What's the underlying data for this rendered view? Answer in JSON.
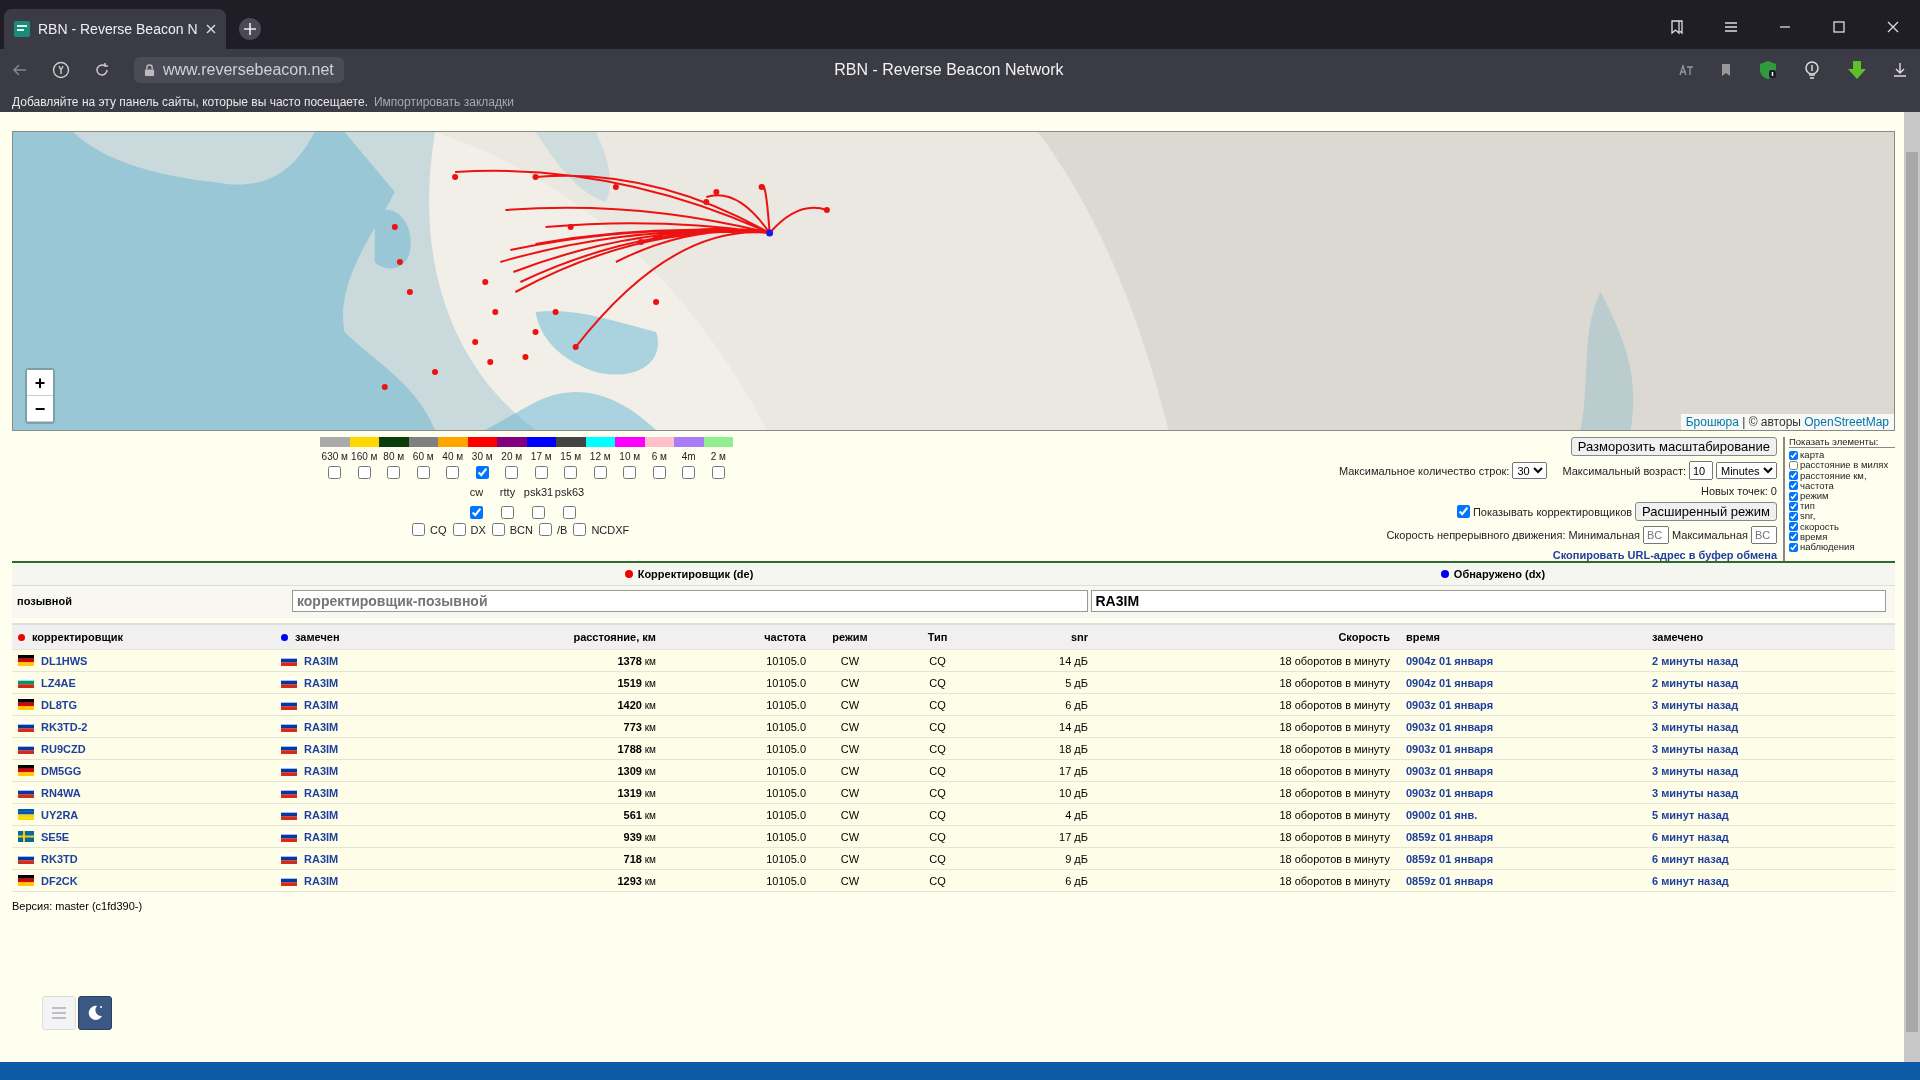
{
  "browser": {
    "tab_title": "RBN - Reverse Beacon N",
    "url": "www.reversebeacon.net",
    "page_title": "RBN - Reverse Beacon Network",
    "bookmarks_hint": "Добавляйте на эту панель сайты, которые вы часто посещаете.",
    "import_link": "Импортировать закладки"
  },
  "map": {
    "zoom_in": "+",
    "zoom_out": "−",
    "attribution_link": "Брошюра",
    "attribution_text": " | © авторы ",
    "osm_link": "OpenStreetMap"
  },
  "bands": [
    {
      "label": "630 м",
      "color": "#aaaaaa",
      "checked": false
    },
    {
      "label": "160 м",
      "color": "#ffd700",
      "checked": false
    },
    {
      "label": "80 м",
      "color": "#0b3d0b",
      "checked": false
    },
    {
      "label": "60 м",
      "color": "#808080",
      "checked": false
    },
    {
      "label": "40 м",
      "color": "#ffa500",
      "checked": false
    },
    {
      "label": "30 м",
      "color": "#ff0000",
      "checked": true
    },
    {
      "label": "20 м",
      "color": "#800080",
      "checked": false
    },
    {
      "label": "17 м",
      "color": "#0000ff",
      "checked": false
    },
    {
      "label": "15 м",
      "color": "#444444",
      "checked": false
    },
    {
      "label": "12 м",
      "color": "#00ffff",
      "checked": false
    },
    {
      "label": "10 м",
      "color": "#ff00ff",
      "checked": false
    },
    {
      "label": "6 м",
      "color": "#ffc0cb",
      "checked": false
    },
    {
      "label": "4m",
      "color": "#a87cf7",
      "checked": false
    },
    {
      "label": "2 м",
      "color": "#90ee90",
      "checked": false
    }
  ],
  "modes": [
    {
      "label": "cw",
      "checked": true
    },
    {
      "label": "rtty",
      "checked": false
    },
    {
      "label": "psk31",
      "checked": false
    },
    {
      "label": "psk63",
      "checked": false
    }
  ],
  "types": [
    {
      "label": "CQ",
      "checked": false
    },
    {
      "label": "DX",
      "checked": false
    },
    {
      "label": "BCN",
      "checked": false
    },
    {
      "label": "/B",
      "checked": false
    },
    {
      "label": "NCDXF",
      "checked": false
    }
  ],
  "controls": {
    "unfreeze_button": "Разморозить масштабирование",
    "max_rows_label": "Максимальное количество строк:",
    "max_rows_value": "30",
    "max_age_label": "Максимальный возраст:",
    "max_age_value": "10",
    "age_unit": "Minutes",
    "new_points": "Новых точек: 0",
    "show_spotters_label": "Показывать корректировщиков",
    "show_spotters_checked": true,
    "advanced_button": "Расширенный режим",
    "speed_label": "Скорость непрерывного движения: Минимальная",
    "min_placeholder": "BC",
    "max_label": "Максимальная",
    "max_placeholder": "BC",
    "copy_link": "Скопировать URL-адрес в буфер обмена"
  },
  "show_elements": {
    "title": "Показать элементы:",
    "items": [
      {
        "label": "карта",
        "checked": true
      },
      {
        "label": "расстояние в милях",
        "checked": false
      },
      {
        "label": "расстояние км,",
        "checked": true
      },
      {
        "label": "частота",
        "checked": true
      },
      {
        "label": "режим",
        "checked": true
      },
      {
        "label": "тип",
        "checked": true
      },
      {
        "label": "snr,",
        "checked": true
      },
      {
        "label": "скорость",
        "checked": true
      },
      {
        "label": "время",
        "checked": true
      },
      {
        "label": "наблюдения",
        "checked": true
      }
    ]
  },
  "filter": {
    "de_header": "Корректировщик (de)",
    "dx_header": "Обнаружено (dx)",
    "row_label": "позывной",
    "de_placeholder": "корректировщик-позывной",
    "dx_value": "RA3IM"
  },
  "table": {
    "columns": [
      "корректировщик",
      "замечен",
      "расстояние, км",
      "частота",
      "режим",
      "Тип",
      "snr",
      "Скорость",
      "время",
      "замечено"
    ],
    "rows": [
      {
        "spotter_flag": {
          "kind": "de"
        },
        "spotter": "DL1HWS",
        "spotted_flag": {
          "kind": "ru"
        },
        "spotted": "RA3IM",
        "distance": "**1378** км",
        "frequency": "10105.0",
        "mode": "CW",
        "type": "CQ",
        "snr": "14 дБ",
        "speed": "18 оборотов в минуту",
        "time": "0904z 01 января",
        "seen": "2 минуты назад"
      },
      {
        "spotter_flag": {
          "kind": "bg"
        },
        "spotter": "LZ4AE",
        "spotted_flag": {
          "kind": "ru"
        },
        "spotted": "RA3IM",
        "distance": "**1519** км",
        "frequency": "10105.0",
        "mode": "CW",
        "type": "CQ",
        "snr": "5 дБ",
        "speed": "18 оборотов в минуту",
        "time": "0904z 01 января",
        "seen": "2 минуты назад"
      },
      {
        "spotter_flag": {
          "kind": "de"
        },
        "spotter": "DL8TG",
        "spotted_flag": {
          "kind": "ru"
        },
        "spotted": "RA3IM",
        "distance": "**1420** км",
        "frequency": "10105.0",
        "mode": "CW",
        "type": "CQ",
        "snr": "6 дБ",
        "speed": "18 оборотов в минуту",
        "time": "0903z 01 января",
        "seen": "3 минуты назад"
      },
      {
        "spotter_flag": {
          "kind": "ru"
        },
        "spotter": "RK3TD-2",
        "spotted_flag": {
          "kind": "ru"
        },
        "spotted": "RA3IM",
        "distance": "**773** км",
        "frequency": "10105.0",
        "mode": "CW",
        "type": "CQ",
        "snr": "14 дБ",
        "speed": "18 оборотов в минуту",
        "time": "0903z 01 января",
        "seen": "3 минуты назад"
      },
      {
        "spotter_flag": {
          "kind": "ru"
        },
        "spotter": "RU9CZD",
        "spotted_flag": {
          "kind": "ru"
        },
        "spotted": "RA3IM",
        "distance": "**1788** км",
        "frequency": "10105.0",
        "mode": "CW",
        "type": "CQ",
        "snr": "18 дБ",
        "speed": "18 оборотов в минуту",
        "time": "0903z 01 января",
        "seen": "3 минуты назад"
      },
      {
        "spotter_flag": {
          "kind": "de"
        },
        "spotter": "DM5GG",
        "spotted_flag": {
          "kind": "ru"
        },
        "spotted": "RA3IM",
        "distance": "**1309** км",
        "frequency": "10105.0",
        "mode": "CW",
        "type": "CQ",
        "snr": "17 дБ",
        "speed": "18 оборотов в минуту",
        "time": "0903z 01 января",
        "seen": "3 минуты назад"
      },
      {
        "spotter_flag": {
          "kind": "ru"
        },
        "spotter": "RN4WA",
        "spotted_flag": {
          "kind": "ru"
        },
        "spotted": "RA3IM",
        "distance": "**1319** км",
        "frequency": "10105.0",
        "mode": "CW",
        "type": "CQ",
        "snr": "10 дБ",
        "speed": "18 оборотов в минуту",
        "time": "0903z 01 января",
        "seen": "3 минуты назад"
      },
      {
        "spotter_flag": {
          "kind": "ua"
        },
        "spotter": "UY2RA",
        "spotted_flag": {
          "kind": "ru"
        },
        "spotted": "RA3IM",
        "distance": "**561** км",
        "frequency": "10105.0",
        "mode": "CW",
        "type": "CQ",
        "snr": "4 дБ",
        "speed": "18 оборотов в минуту",
        "time": "0900z 01 янв.",
        "seen": "5 минут назад"
      },
      {
        "spotter_flag": {
          "kind": "se"
        },
        "spotter": "SE5E",
        "spotted_flag": {
          "kind": "ru"
        },
        "spotted": "RA3IM",
        "distance": "**939** км",
        "frequency": "10105.0",
        "mode": "CW",
        "type": "CQ",
        "snr": "17 дБ",
        "speed": "18 оборотов в минуту",
        "time": "0859z 01 января",
        "seen": "6 минут назад"
      },
      {
        "spotter_flag": {
          "kind": "ru"
        },
        "spotter": "RK3TD",
        "spotted_flag": {
          "kind": "ru"
        },
        "spotted": "RA3IM",
        "distance": "**718** км",
        "frequency": "10105.0",
        "mode": "CW",
        "type": "CQ",
        "snr": "9 дБ",
        "speed": "18 оборотов в минуту",
        "time": "0859z 01 января",
        "seen": "6 минут назад"
      },
      {
        "spotter_flag": {
          "kind": "de"
        },
        "spotter": "DF2CK",
        "spotted_flag": {
          "kind": "ru"
        },
        "spotted": "RA3IM",
        "distance": "**1293** км",
        "frequency": "10105.0",
        "mode": "CW",
        "type": "CQ",
        "snr": "6 дБ",
        "speed": "18 оборотов в минуту",
        "time": "0859z 01 января",
        "seen": "6 минут назад"
      }
    ]
  },
  "version": "Версия: master (c1fd390-)"
}
